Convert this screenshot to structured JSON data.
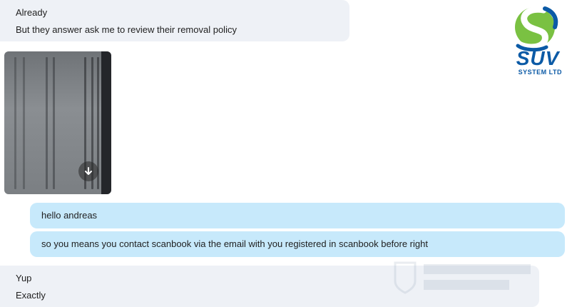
{
  "messages": {
    "in1_line1": "Already",
    "in1_line2": "But they answer ask me to review their removal policy",
    "out1": "hello andreas",
    "out2": "so you means you contact scanbook via the email with you registered in scanbook before right",
    "in2_line1": "Yup",
    "in2_line2": "Exactly"
  },
  "logo": {
    "brand": "SUV",
    "subtitle": "SYSTEM LTD"
  },
  "icons": {
    "download": "download-arrow-icon"
  },
  "colors": {
    "incoming_bubble": "#eef1f6",
    "outgoing_bubble": "#c7e9fb",
    "logo_blue": "#0b5aa6",
    "logo_green": "#7ac142"
  }
}
